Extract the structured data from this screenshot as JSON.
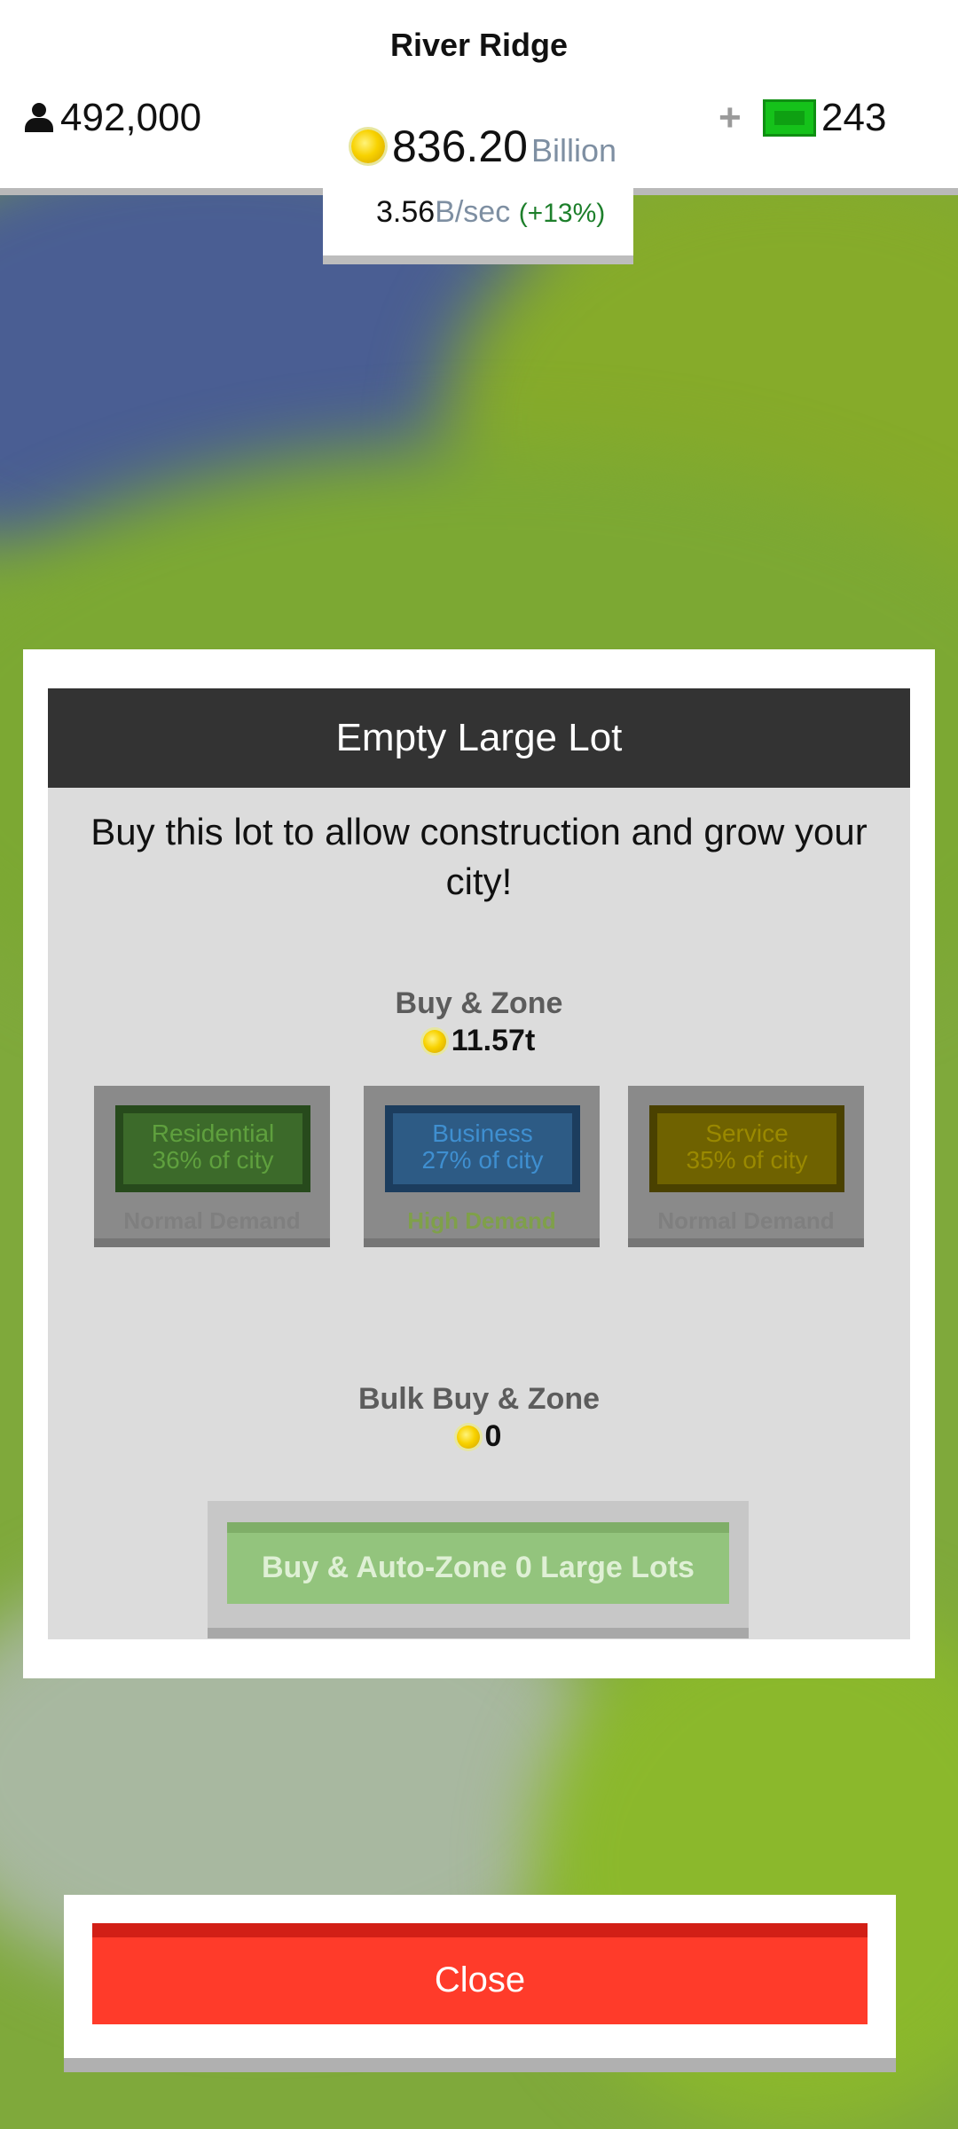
{
  "header": {
    "city_name": "River Ridge",
    "population": "492,000",
    "money_value": "836.20",
    "money_unit": "Billion",
    "income_value": "3.56",
    "income_unit": "B/sec",
    "income_pct": "(+13%)",
    "plus_label": "+",
    "bucks": "243"
  },
  "modal": {
    "title": "Empty Large Lot",
    "description": "Buy this lot to allow construction and grow your city!",
    "buy_zone_title": "Buy & Zone",
    "buy_zone_price": "11.57t",
    "zones": [
      {
        "name": "Residential",
        "share": "36% of city",
        "demand": "Normal Demand",
        "color": "#3f7f2a"
      },
      {
        "name": "Business",
        "share": "27% of city",
        "demand": "High Demand",
        "color": "#2f6fa5"
      },
      {
        "name": "Service",
        "share": "35% of city",
        "demand": "Normal Demand",
        "color": "#8a7a00"
      }
    ],
    "bulk_title": "Bulk Buy & Zone",
    "bulk_price": "0",
    "bulk_button": "Buy & Auto-Zone 0 Large Lots"
  },
  "footer": {
    "close_label": "Close"
  }
}
